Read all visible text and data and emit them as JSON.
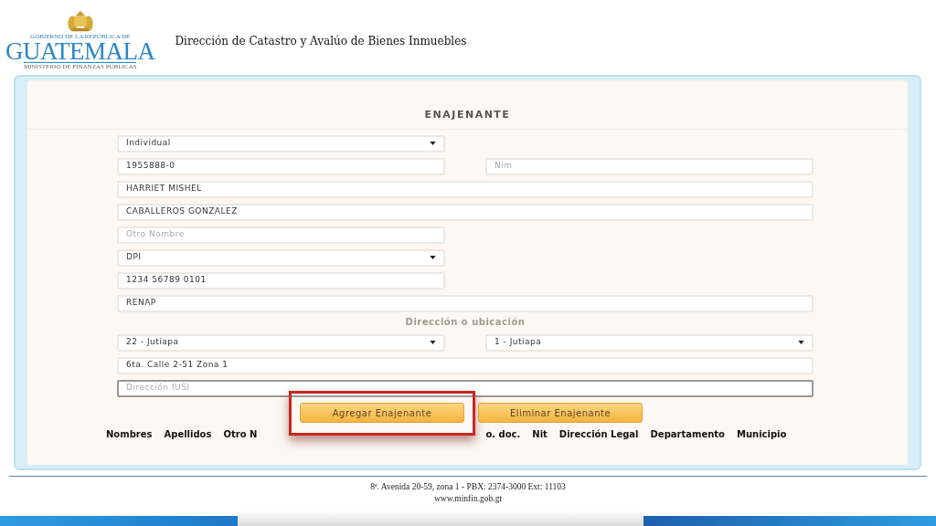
{
  "header": {
    "logo": {
      "top_line": "GOBIERNO DE LA REPÚBLICA DE",
      "name": "GUATEMALA",
      "bottom_line": "MINISTERIO DE FINANZAS PÚBLICAS"
    },
    "title": "Dirección de Catastro y Avalúo de Bienes Inmuebles"
  },
  "form": {
    "title": "ENAJENANTE",
    "field_lines": [
      [
        {
          "kind": "dropdown",
          "value": "Individual"
        }
      ],
      [
        {
          "kind": "short-field",
          "value": "1955888-0"
        },
        {
          "kind": "short-field",
          "placeholder": "Nim"
        }
      ],
      [
        {
          "kind": "long-field",
          "value": "HARRIET MISHEL"
        }
      ],
      [
        {
          "kind": "long-field",
          "value": "CABALLEROS GONZALEZ"
        }
      ],
      [
        {
          "kind": "short-field",
          "placeholder": "Otro Nombre"
        }
      ],
      [
        {
          "kind": "dropdown",
          "value": "DPI"
        }
      ],
      [
        {
          "kind": "short-field",
          "value": "1234 56789 0101"
        }
      ],
      [
        {
          "kind": "long-field",
          "value": "RENAP"
        }
      ],
      [
        {
          "kind": "section",
          "text": "Dirección o ubicación"
        }
      ],
      [
        {
          "kind": "dropdown",
          "value": "22 - Jutiapa"
        },
        {
          "kind": "dropdown",
          "value": "1 - Jutiapa"
        }
      ],
      [
        {
          "kind": "long-field",
          "value": "6ta. Calle 2-51 Zona 1"
        }
      ],
      [
        {
          "kind": "long-field",
          "placeholder": "Dirección IUSI",
          "focused": true
        }
      ]
    ],
    "buttons": [
      {
        "label": "Agregar Enajenante",
        "highlighted": true
      },
      {
        "label": "Eliminar Enajenante",
        "highlighted": false
      }
    ],
    "columns": [
      "Nombres",
      "Apellidos",
      "Otro N",
      "o. doc.",
      "Nit",
      "Dirección Legal",
      "Departamento",
      "Municipio"
    ]
  },
  "footer": {
    "address": "8ª. Avenida 20-59, zona 1 -  PBX: 2374-3000  Ext: 11103",
    "website": "www.minfin.gob.gt"
  }
}
